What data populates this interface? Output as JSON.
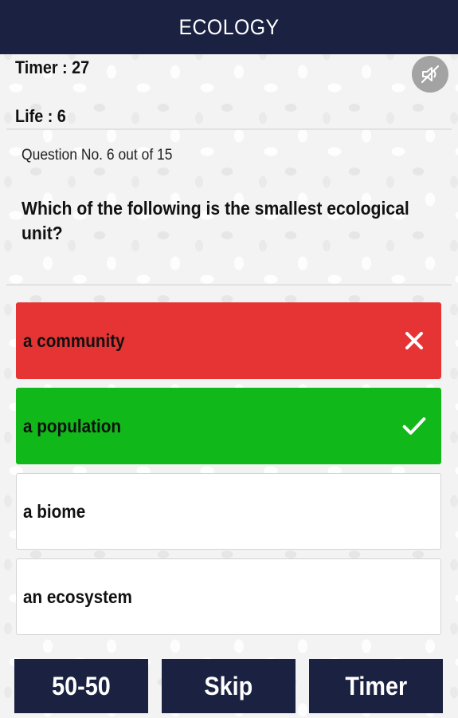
{
  "header": {
    "title": "ECOLOGY"
  },
  "stats": {
    "timer_text": "Timer  : 27",
    "life_text": "Life : 6"
  },
  "sound_toggle": {
    "icon": "sound-muted-icon",
    "state": "muted"
  },
  "question": {
    "counter_text": "Question No. 6 out of 15",
    "text": "Which of the following is the smallest ecological unit?"
  },
  "options": [
    {
      "text": "a community",
      "state": "wrong",
      "icon": "close-icon"
    },
    {
      "text": "a population",
      "state": "correct",
      "icon": "check-icon"
    },
    {
      "text": "a biome",
      "state": "neutral"
    },
    {
      "text": "an ecosystem",
      "state": "neutral"
    }
  ],
  "lifelines": [
    {
      "label": "50-50"
    },
    {
      "label": "Skip"
    },
    {
      "label": "Timer"
    }
  ],
  "colors": {
    "header_bg": "#1b2141",
    "wrong": "#e63434",
    "correct": "#10b81a",
    "button_bg": "#1b2141"
  }
}
